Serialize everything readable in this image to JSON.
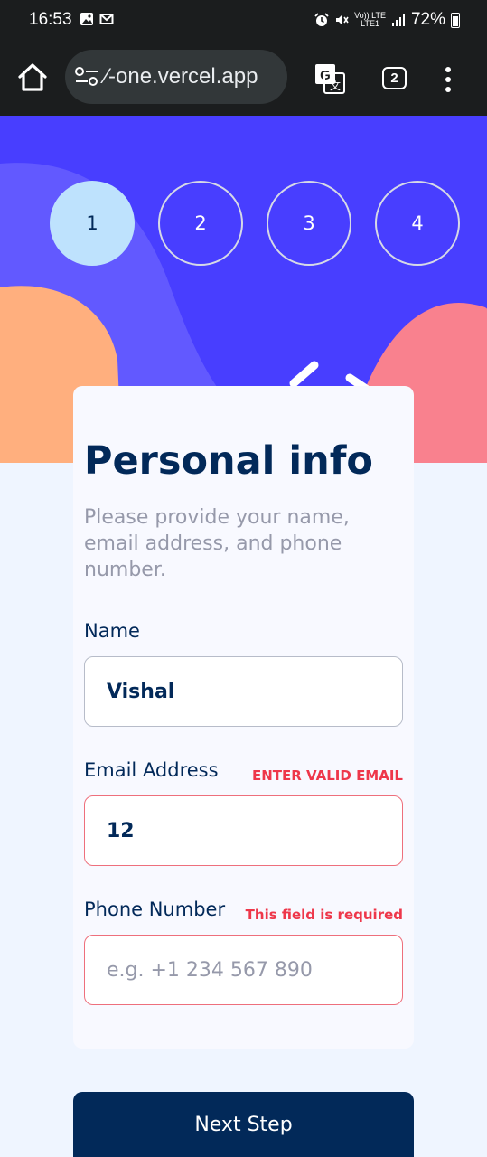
{
  "status_bar": {
    "time": "16:53",
    "network_top": "Vo)) LTE",
    "network_bottom": "LTE1",
    "battery": "72%"
  },
  "browser": {
    "url": "⁄-one.vercel.app",
    "tab_count": "2"
  },
  "steps": [
    "1",
    "2",
    "3",
    "4"
  ],
  "active_step": 1,
  "form": {
    "title": "Personal info",
    "subtitle": "Please provide your name, email address, and phone number.",
    "fields": [
      {
        "label": "Name",
        "value": "Vishal",
        "placeholder": "",
        "error": ""
      },
      {
        "label": "Email Address",
        "value": "12",
        "placeholder": "",
        "error": "ENTER VALID EMAIL"
      },
      {
        "label": "Phone Number",
        "value": "",
        "placeholder": "e.g. +1 234 567 890",
        "error": "This field is required"
      }
    ],
    "next_label": "Next Step"
  },
  "colors": {
    "primary": "#022959",
    "accent": "#483eff",
    "error": "#ee374a",
    "active_step": "#bee2fd"
  }
}
